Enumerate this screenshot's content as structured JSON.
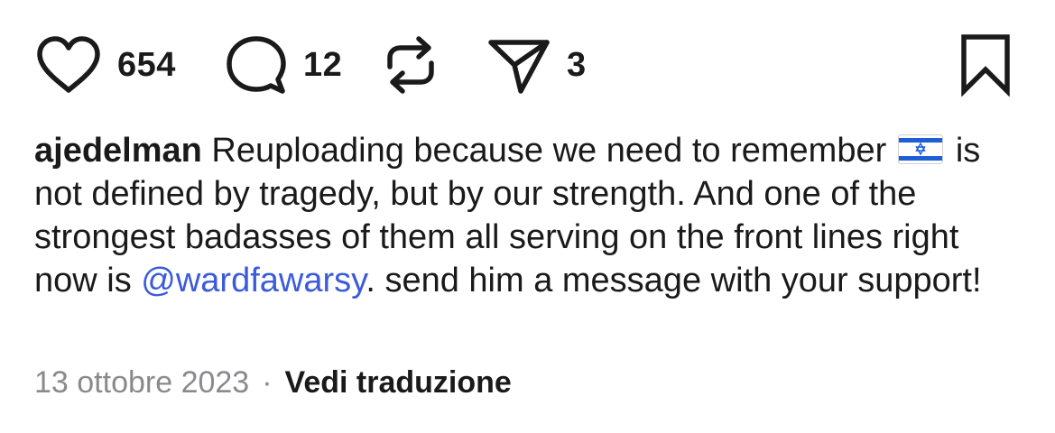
{
  "actions": {
    "like": {
      "icon": "heart-icon",
      "count": "654"
    },
    "comment": {
      "icon": "comment-bubble-icon",
      "count": "12"
    },
    "repost": {
      "icon": "repost-icon"
    },
    "share": {
      "icon": "paper-plane-icon",
      "count": "3"
    },
    "save": {
      "icon": "bookmark-icon"
    }
  },
  "caption": {
    "username": "ajedelman",
    "text_part1": " Reuploading because we need to remember ",
    "flag": "israel-flag-icon",
    "text_part2": "is not defined by tragedy, but by our strength. And one of the strongest badasses of them all serving on the front lines right now is ",
    "mention": "@wardfawarsy",
    "text_part3": ". send him a message with your support!"
  },
  "meta": {
    "date": "13 ottobre 2023",
    "separator": "·",
    "translate_label": "Vedi traduzione"
  },
  "colors": {
    "text": "#1a1a1a",
    "muted": "#8a8a8e",
    "mention": "#3b5bdb",
    "flag_blue": "#1f5fd6"
  }
}
